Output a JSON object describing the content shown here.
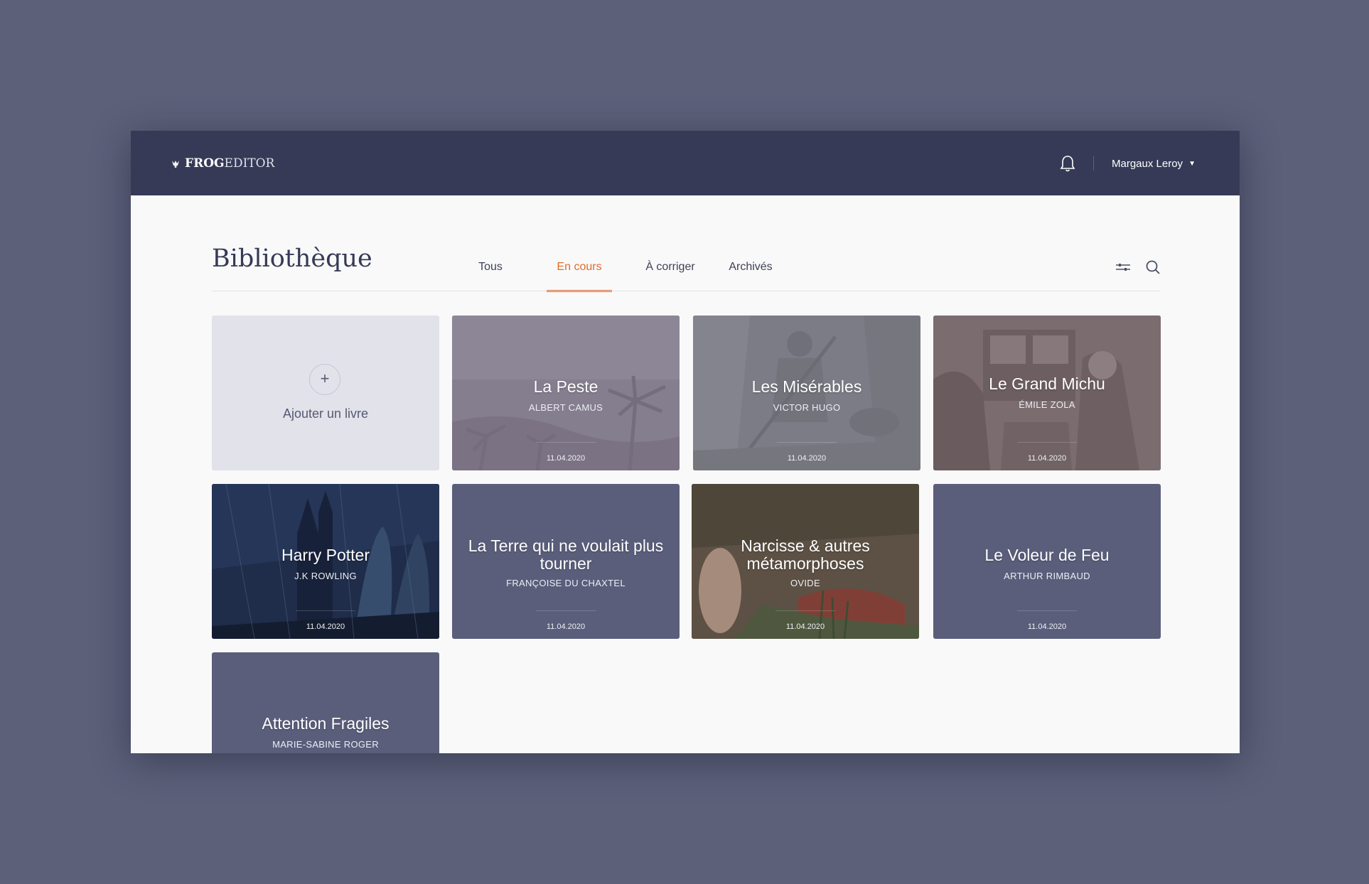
{
  "app": {
    "logo_bold": "FROG",
    "logo_light": "EDITOR",
    "user_name": "Margaux Leroy"
  },
  "page": {
    "title": "Bibliothèque",
    "tabs": [
      {
        "label": "Tous",
        "active": false
      },
      {
        "label": "En cours",
        "active": true
      },
      {
        "label": "À corriger",
        "active": false
      },
      {
        "label": "Archivés",
        "active": false
      }
    ]
  },
  "add_card": {
    "label": "Ajouter un livre",
    "icon": "+"
  },
  "books": [
    {
      "title": "La Peste",
      "author": "ALBERT CAMUS",
      "date": "11.04.2020",
      "cover": "palms"
    },
    {
      "title": "Les Misérables",
      "author": "VICTOR HUGO",
      "date": "11.04.2020",
      "cover": "engraving-grey"
    },
    {
      "title": "Le Grand Michu",
      "author": "ÉMILE ZOLA",
      "date": "11.04.2020",
      "cover": "engraving-brown"
    },
    {
      "title": "Harry Potter",
      "author": "J.K ROWLING",
      "date": "11.04.2020",
      "cover": "blue-castle"
    },
    {
      "title": "La Terre qui ne voulait plus tourner",
      "author": "FRANÇOISE DU CHAXTEL",
      "date": "11.04.2020",
      "cover": "none"
    },
    {
      "title": "Narcisse & autres métamorphoses",
      "author": "OVIDE",
      "date": "11.04.2020",
      "cover": "painting"
    },
    {
      "title": "Le Voleur de Feu",
      "author": "ARTHUR RIMBAUD",
      "date": "11.04.2020",
      "cover": "none"
    },
    {
      "title": "Attention Fragiles",
      "author": "MARIE-SABINE ROGER",
      "date": "",
      "cover": "none"
    }
  ],
  "colors": {
    "background": "#5c6079",
    "topbar": "#363a57",
    "accent": "#e8692a",
    "card_plain": "#5a5e7b",
    "add_card": "#e2e2ea"
  }
}
